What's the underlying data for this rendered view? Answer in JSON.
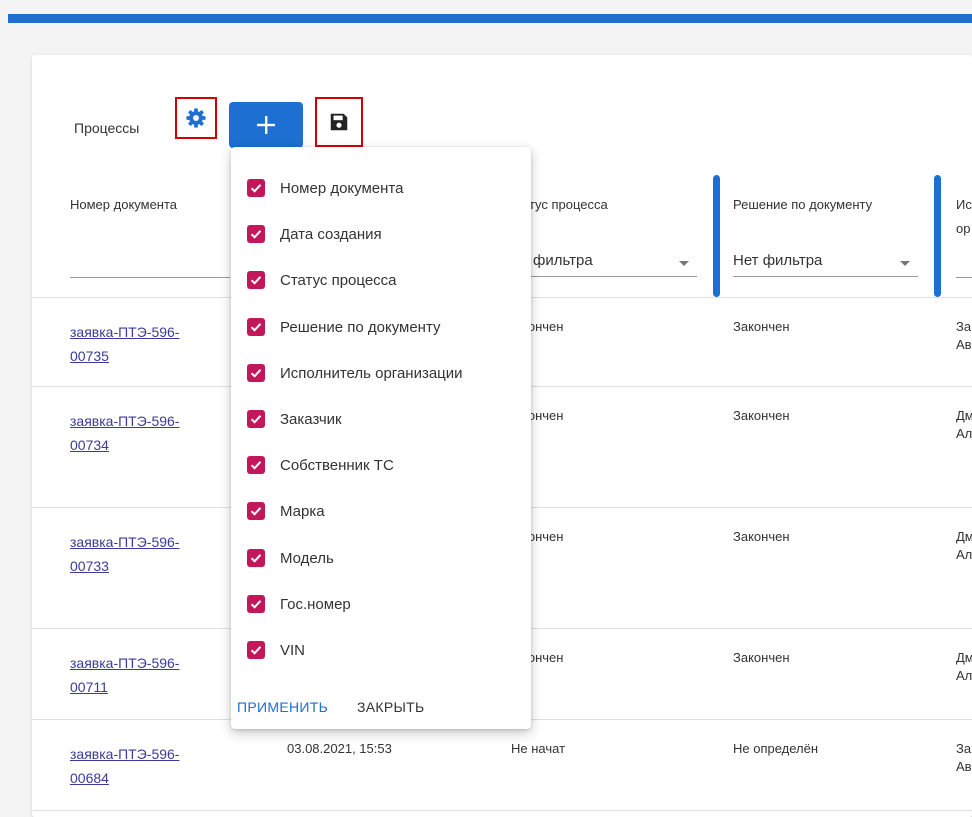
{
  "toolbar": {
    "title": "Процессы",
    "settings_icon": "gear-icon",
    "add_icon": "plus-icon",
    "save_icon": "floppy-disk-icon"
  },
  "colors": {
    "accent": "#1d6fd1",
    "checkbox": "#c2185b",
    "highlight": "#d40000"
  },
  "table": {
    "headers": {
      "doc_number": "Номер документа",
      "status": "атус процесса",
      "decision": "Решение по документу",
      "executor_line1": "Ис",
      "executor_line2": "ор"
    },
    "filters": {
      "status": "т фильтра",
      "decision": "Нет фильтра"
    },
    "rows": [
      {
        "doc_line1": "заявка-ПТЭ-596-",
        "doc_line2": "00735",
        "created": "",
        "status": "кончен",
        "decision": "Закончен",
        "exec_line1": "За",
        "exec_line2": "Ав"
      },
      {
        "doc_line1": "заявка-ПТЭ-596-",
        "doc_line2": "00734",
        "created": "",
        "status": "кончен",
        "decision": "Закончен",
        "exec_line1": "Дм",
        "exec_line2": "Ал"
      },
      {
        "doc_line1": "заявка-ПТЭ-596-",
        "doc_line2": "00733",
        "created": "",
        "status": "кончен",
        "decision": "Закончен",
        "exec_line1": "Дм",
        "exec_line2": "Ал"
      },
      {
        "doc_line1": "заявка-ПТЭ-596-",
        "doc_line2": "00711",
        "created": "",
        "status": "кончен",
        "decision": "Закончен",
        "exec_line1": "Дм",
        "exec_line2": "Ал"
      },
      {
        "doc_line1": "заявка-ПТЭ-596-",
        "doc_line2": "00684",
        "created": "03.08.2021, 15:53",
        "status": "Не начат",
        "decision": "Не определён",
        "exec_line1": "За",
        "exec_line2": "Ав"
      }
    ]
  },
  "column_menu": {
    "items": [
      {
        "label": "Номер документа",
        "checked": true
      },
      {
        "label": "Дата создания",
        "checked": true
      },
      {
        "label": "Статус процесса",
        "checked": true
      },
      {
        "label": "Решение по документу",
        "checked": true
      },
      {
        "label": "Исполнитель организации",
        "checked": true
      },
      {
        "label": "Заказчик",
        "checked": true
      },
      {
        "label": "Собственник ТС",
        "checked": true
      },
      {
        "label": "Марка",
        "checked": true
      },
      {
        "label": "Модель",
        "checked": true
      },
      {
        "label": "Гос.номер",
        "checked": true
      },
      {
        "label": "VIN",
        "checked": true
      }
    ],
    "apply_label": "ПРИМЕНИТЬ",
    "close_label": "ЗАКРЫТЬ"
  }
}
